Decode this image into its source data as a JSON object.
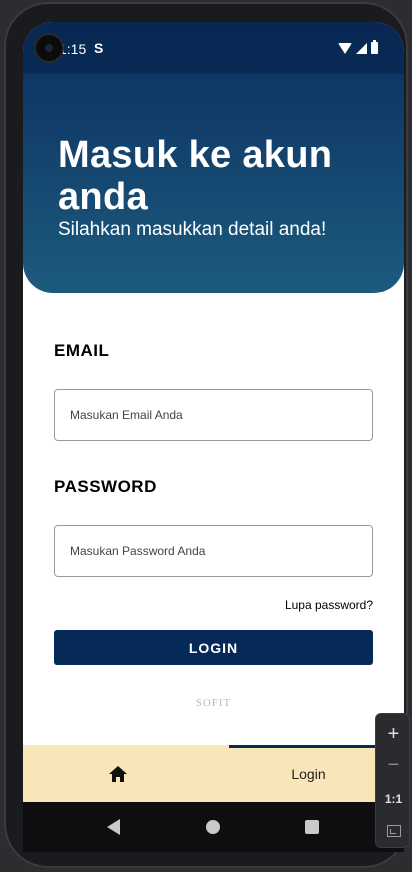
{
  "status_bar": {
    "time": "1:15",
    "sim_icon": "S"
  },
  "header": {
    "title": "Masuk ke akun anda",
    "subtitle": "Silahkan masukkan detail anda!"
  },
  "form": {
    "email_label": "EMAIL",
    "email_placeholder": "Masukan Email Anda",
    "email_value": "",
    "password_label": "PASSWORD",
    "password_placeholder": "Masukan Password Anda",
    "password_value": "",
    "forgot_password": "Lupa password?",
    "login_button": "LOGIN"
  },
  "brand": "SOFIT",
  "bottom_nav": {
    "home_icon": "home-icon",
    "login_label": "Login",
    "active_tab": "Login"
  },
  "emulator_zoom": {
    "zoom_in": "+",
    "zoom_out": "−",
    "ratio": "1:1"
  },
  "colors": {
    "header_top": "#0a2f5e",
    "header_bottom": "#1c5b7d",
    "login_button": "#062a58",
    "bottom_nav_bg": "#f8e5b8"
  }
}
